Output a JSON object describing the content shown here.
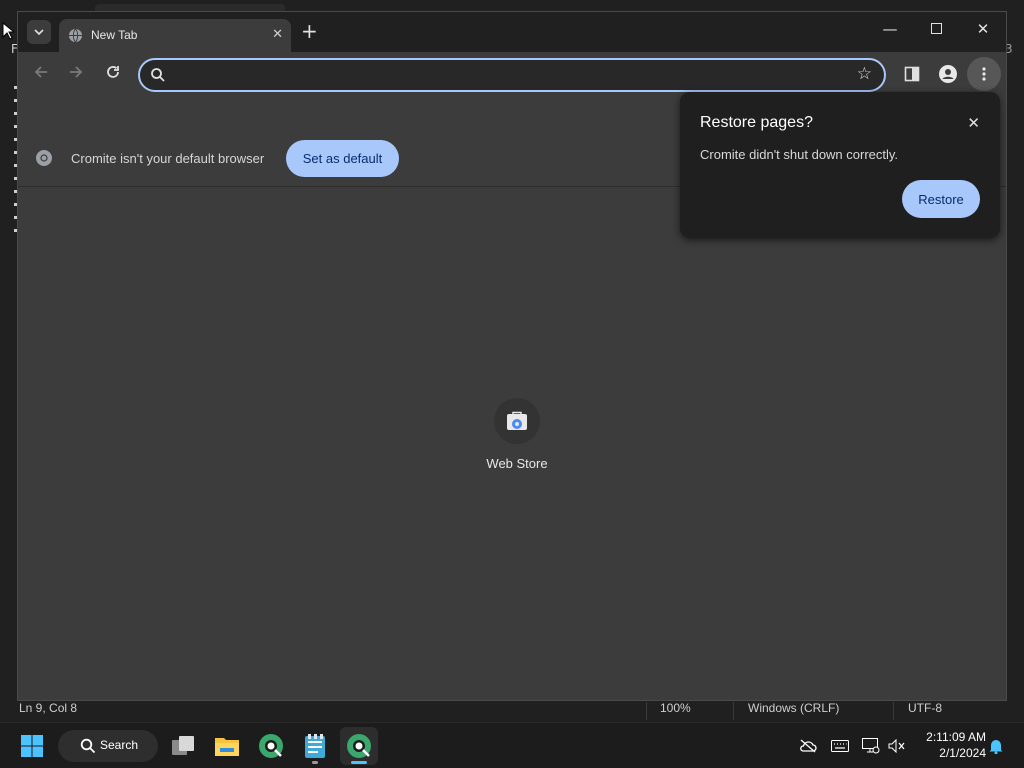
{
  "background_window": {
    "left_char": "F",
    "right_char": "3",
    "status": {
      "position": "Ln 9, Col 8",
      "zoom": "100%",
      "line_ending": "Windows (CRLF)",
      "encoding": "UTF-8"
    }
  },
  "browser": {
    "tab": {
      "title": "New Tab",
      "icon": "globe-icon"
    },
    "omnibox": {
      "placeholder": "",
      "value": ""
    },
    "infobar": {
      "message": "Cromite isn't your default browser",
      "button_label": "Set as default"
    },
    "shortcut": {
      "label": "Web Store",
      "icon": "web-store-icon"
    },
    "restore_popup": {
      "title": "Restore pages?",
      "message": "Cromite didn't shut down correctly.",
      "button_label": "Restore"
    },
    "accent_color": "#a8c7fa"
  },
  "taskbar": {
    "search_label": "Search",
    "time": "2:11:09 AM",
    "date": "2/1/2024",
    "apps": [
      "start-icon",
      "task-view-icon",
      "file-explorer-icon",
      "cromite-icon",
      "notepad-icon",
      "cromite-active-icon"
    ]
  }
}
